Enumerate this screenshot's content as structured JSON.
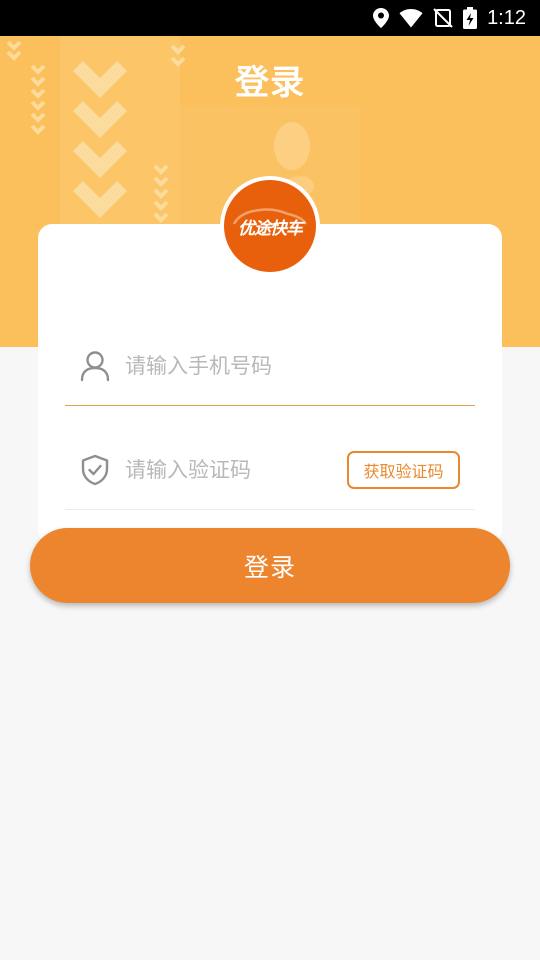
{
  "status_bar": {
    "time": "1:12",
    "icons": [
      "location-icon",
      "wifi-icon",
      "no-sim-icon",
      "battery-icon"
    ]
  },
  "header": {
    "title": "登录"
  },
  "logo": {
    "text": "优途快车",
    "colors": {
      "badge": "#e8600c",
      "ring": "#ffffff"
    }
  },
  "form": {
    "phone": {
      "icon": "user-icon",
      "value": "",
      "placeholder": "请输入手机号码"
    },
    "code": {
      "icon": "shield-check-icon",
      "value": "",
      "placeholder": "请输入验证码",
      "get_code_label": "获取验证码"
    },
    "login_label": "登录"
  },
  "colors": {
    "hero_background": "#fbbf5c",
    "accent": "#ec852e",
    "page_background": "#f7f7f7"
  }
}
